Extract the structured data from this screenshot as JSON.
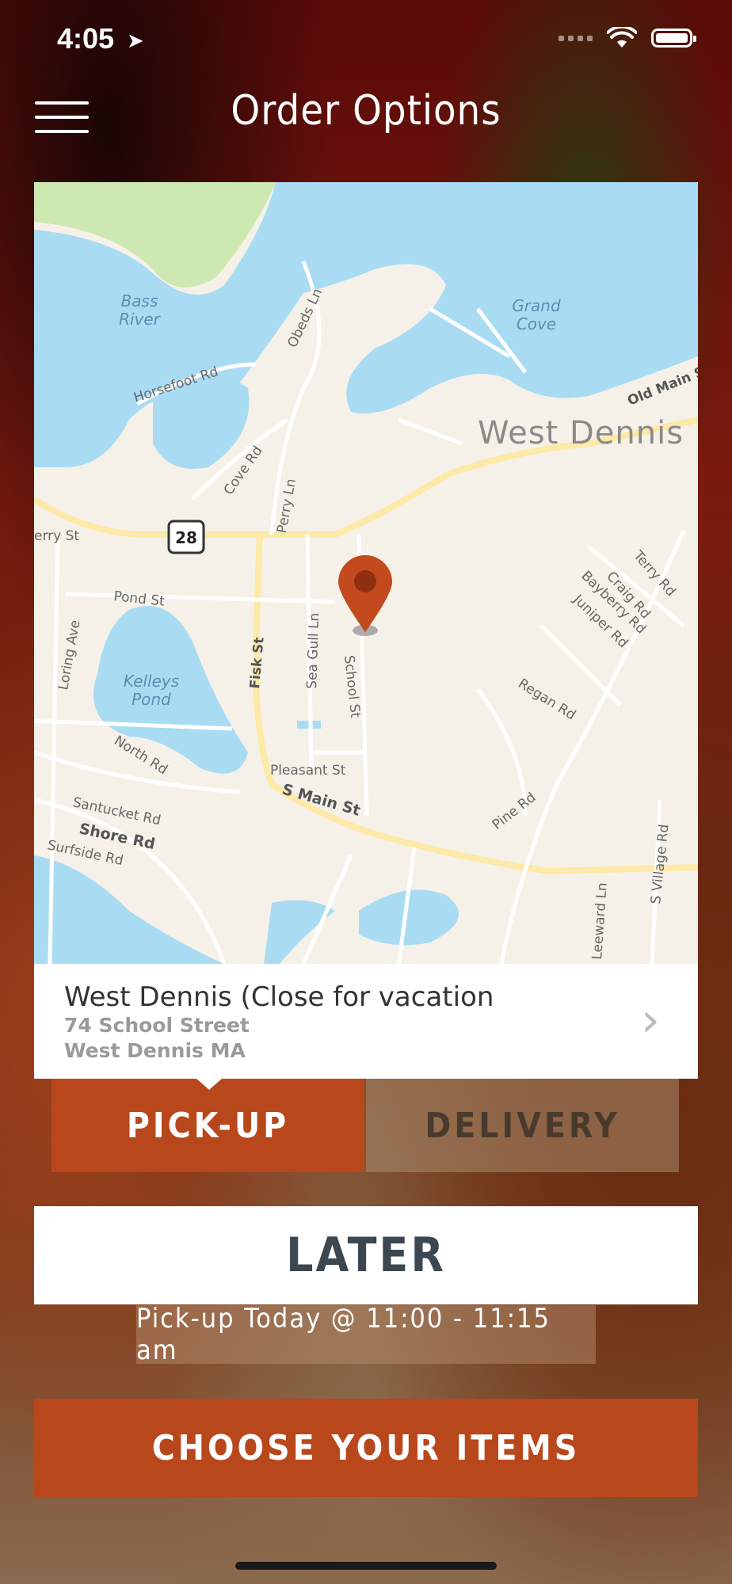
{
  "status_bar": {
    "time": "4:05"
  },
  "header": {
    "title": "Order Options"
  },
  "map": {
    "labels": {
      "bass_river_1": "Bass",
      "bass_river_2": "River",
      "grand_cove_1": "Grand",
      "grand_cove_2": "Cove",
      "west_dennis": "West Dennis",
      "kelleys_1": "Kelleys",
      "kelleys_2": "Pond",
      "obeds": "Obeds Ln",
      "horsefoot": "Horsefoot Rd",
      "cove_rd": "Cove Rd",
      "perry": "Perry Ln",
      "route": "28",
      "erry_st": "erry St",
      "pond_st": "Pond St",
      "loring": "Loring Ave",
      "fisk": "Fisk St",
      "sea_gull": "Sea Gull Ln",
      "school": "School St",
      "terry": "Terry Rd",
      "craig": "Craig Rd",
      "bayberry": "Bayberry Rd",
      "juniper": "Juniper Rd",
      "regan": "Regan Rd",
      "old_main": "Old Main S",
      "north_rd": "North Rd",
      "pleasant": "Pleasant St",
      "s_main": "S Main St",
      "santucket": "Santucket Rd",
      "shore": "Shore Rd",
      "surfside": "Surfside Rd",
      "pine": "Pine Rd",
      "leeward": "Leeward Ln",
      "s_village": "S Village Rd"
    }
  },
  "store": {
    "name": "West Dennis (Close for vacation",
    "address_line1": "74 School Street",
    "address_line2": "West Dennis MA"
  },
  "tabs": {
    "pickup": "PICK-UP",
    "delivery": "DELIVERY"
  },
  "later_label": "LATER",
  "pickup_time": "Pick-up Today @ 11:00 - 11:15 am",
  "cta_label": "CHOOSE YOUR ITEMS",
  "colors": {
    "accent": "#b9471c",
    "water": "#a9dcf3",
    "park": "#cde8b0",
    "land": "#f6f1e8"
  }
}
